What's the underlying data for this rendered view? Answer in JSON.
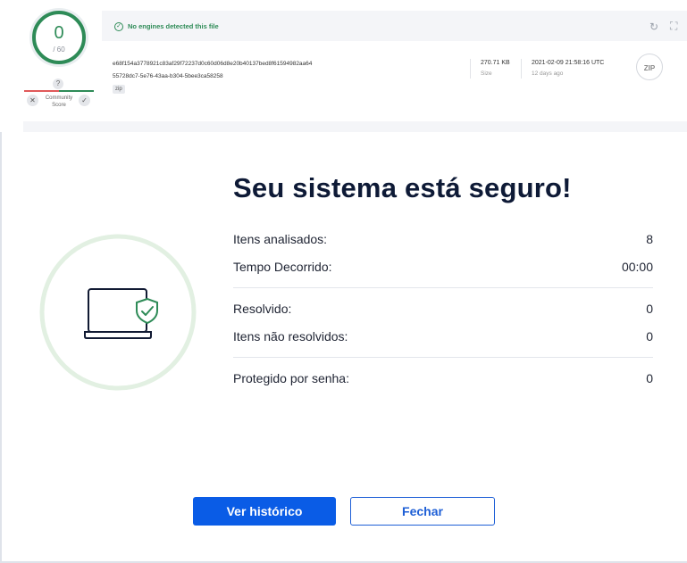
{
  "background_page": {
    "score": {
      "detected": "0",
      "total": "/ 60"
    },
    "question_mark": "?",
    "community_label": "Community Score",
    "vote_down": "✕",
    "vote_up": "✓",
    "status_text": "No engines detected this file",
    "file": {
      "hash": "e68f154a3778921c83af29f72237d0c60d06d8e20b40137bed8f61594982aa64",
      "name": "55728dc7-5e76-43aa-b304-5bee3ca58258",
      "tag": "zip",
      "size": "270.71 KB",
      "size_label": "Size",
      "date": "2021-02-09 21:58:16 UTC",
      "date_ago": "12 days ago",
      "type_icon_label": "ZIP"
    },
    "icons": {
      "refresh": "refresh-icon",
      "graph": "graph-icon",
      "check": "check-circle-icon"
    }
  },
  "modal": {
    "headline": "Seu sistema está seguro!",
    "stats": {
      "items_scanned": {
        "label": "Itens analisados:",
        "value": "8"
      },
      "elapsed_time": {
        "label": "Tempo Decorrido:",
        "value": "00:00"
      },
      "resolved": {
        "label": "Resolvido:",
        "value": "0"
      },
      "unresolved": {
        "label": "Itens não resolvidos:",
        "value": "0"
      },
      "password_protected": {
        "label": "Protegido por senha:",
        "value": "0"
      }
    },
    "buttons": {
      "history": "Ver histórico",
      "close": "Fechar"
    },
    "illustration": {
      "icon": "laptop-shield-icon"
    },
    "colors": {
      "primary": "#0a5ce6",
      "success": "#2e8b57",
      "ring": "#e2f0e2",
      "navy": "#0e1a36"
    }
  }
}
